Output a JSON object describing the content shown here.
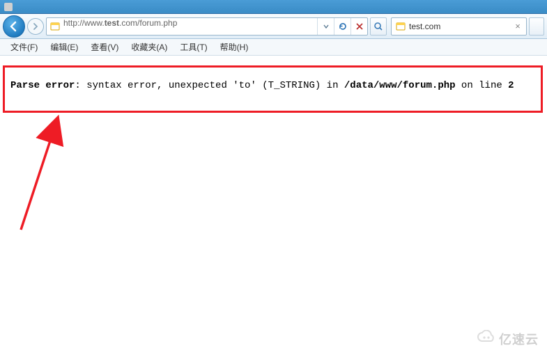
{
  "titlebar": {
    "text": ""
  },
  "address": {
    "prefix": "http://www.",
    "bold": "test",
    "suffix": ".com/forum.php"
  },
  "tab": {
    "label": "test.com"
  },
  "menu": {
    "file": "文件(F)",
    "edit": "编辑(E)",
    "view": "查看(V)",
    "fav": "收藏夹(A)",
    "tools": "工具(T)",
    "help": "帮助(H)"
  },
  "error": {
    "label": "Parse error",
    "msg1": ": syntax error, unexpected 'to' (T_STRING) in ",
    "path": "/data/www/forum.php",
    "msg2": " on line ",
    "line": "2"
  },
  "watermark": {
    "text": "亿速云"
  }
}
